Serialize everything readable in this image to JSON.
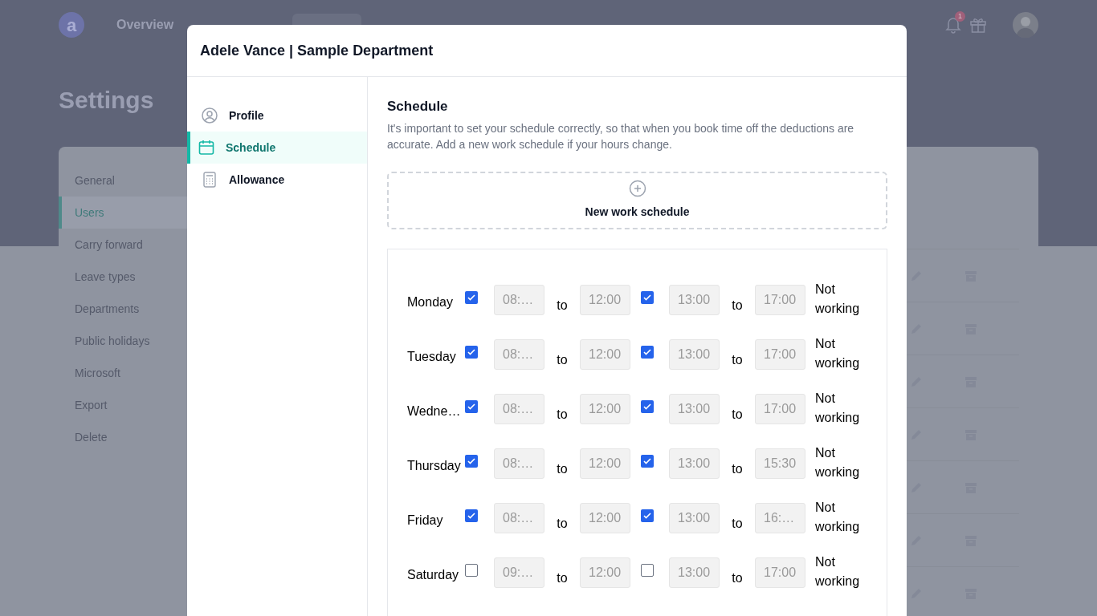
{
  "app_bar": {
    "logo": "a",
    "nav": [
      {
        "label": "Overview"
      }
    ],
    "notification_count": "1"
  },
  "page": {
    "title": "Settings",
    "menu": [
      {
        "label": "General",
        "selected": false
      },
      {
        "label": "Users",
        "selected": true
      },
      {
        "label": "Carry forward",
        "selected": false
      },
      {
        "label": "Leave types",
        "selected": false
      },
      {
        "label": "Departments",
        "selected": false
      },
      {
        "label": "Public holidays",
        "selected": false
      },
      {
        "label": "Microsoft",
        "selected": false
      },
      {
        "label": "Export",
        "selected": false
      },
      {
        "label": "Delete",
        "selected": false
      }
    ]
  },
  "dialog": {
    "title": "Adele Vance | Sample Department",
    "nav": [
      {
        "label": "Profile",
        "kind": "profile",
        "selected": false
      },
      {
        "label": "Schedule",
        "kind": "calendar",
        "selected": true
      },
      {
        "label": "Allowance",
        "kind": "calculator",
        "selected": false
      }
    ],
    "section": {
      "title": "Schedule",
      "description": "It's important to set your schedule correctly, so that when you book time off the deductions are accurate. Add a new work schedule if your hours change."
    },
    "new_schedule_button": "New work schedule",
    "days": [
      {
        "day": "Monday",
        "morning": {
          "checked": true,
          "from": "08:…",
          "separator": "to",
          "to": "12:00"
        },
        "afternoon": {
          "checked": true,
          "from": "13:00",
          "separator": "to",
          "to": "17:00"
        },
        "status": "Not working"
      },
      {
        "day": "Tuesday",
        "morning": {
          "checked": true,
          "from": "08:…",
          "separator": "to",
          "to": "12:00"
        },
        "afternoon": {
          "checked": true,
          "from": "13:00",
          "separator": "to",
          "to": "17:00"
        },
        "status": "Not working"
      },
      {
        "day": "Wedne…",
        "morning": {
          "checked": true,
          "from": "08:…",
          "separator": "to",
          "to": "12:00"
        },
        "afternoon": {
          "checked": true,
          "from": "13:00",
          "separator": "to",
          "to": "17:00"
        },
        "status": "Not working"
      },
      {
        "day": "Thursday",
        "morning": {
          "checked": true,
          "from": "08:…",
          "separator": "to",
          "to": "12:00"
        },
        "afternoon": {
          "checked": true,
          "from": "13:00",
          "separator": "to",
          "to": "15:30"
        },
        "status": "Not working"
      },
      {
        "day": "Friday",
        "morning": {
          "checked": true,
          "from": "08:…",
          "separator": "to",
          "to": "12:00"
        },
        "afternoon": {
          "checked": true,
          "from": "13:00",
          "separator": "to",
          "to": "16:…"
        },
        "status": "Not working"
      },
      {
        "day": "Saturday",
        "morning": {
          "checked": false,
          "from": "09:…",
          "separator": "to",
          "to": "12:00"
        },
        "afternoon": {
          "checked": false,
          "from": "13:00",
          "separator": "to",
          "to": "17:00"
        },
        "status": "Not working"
      }
    ]
  }
}
